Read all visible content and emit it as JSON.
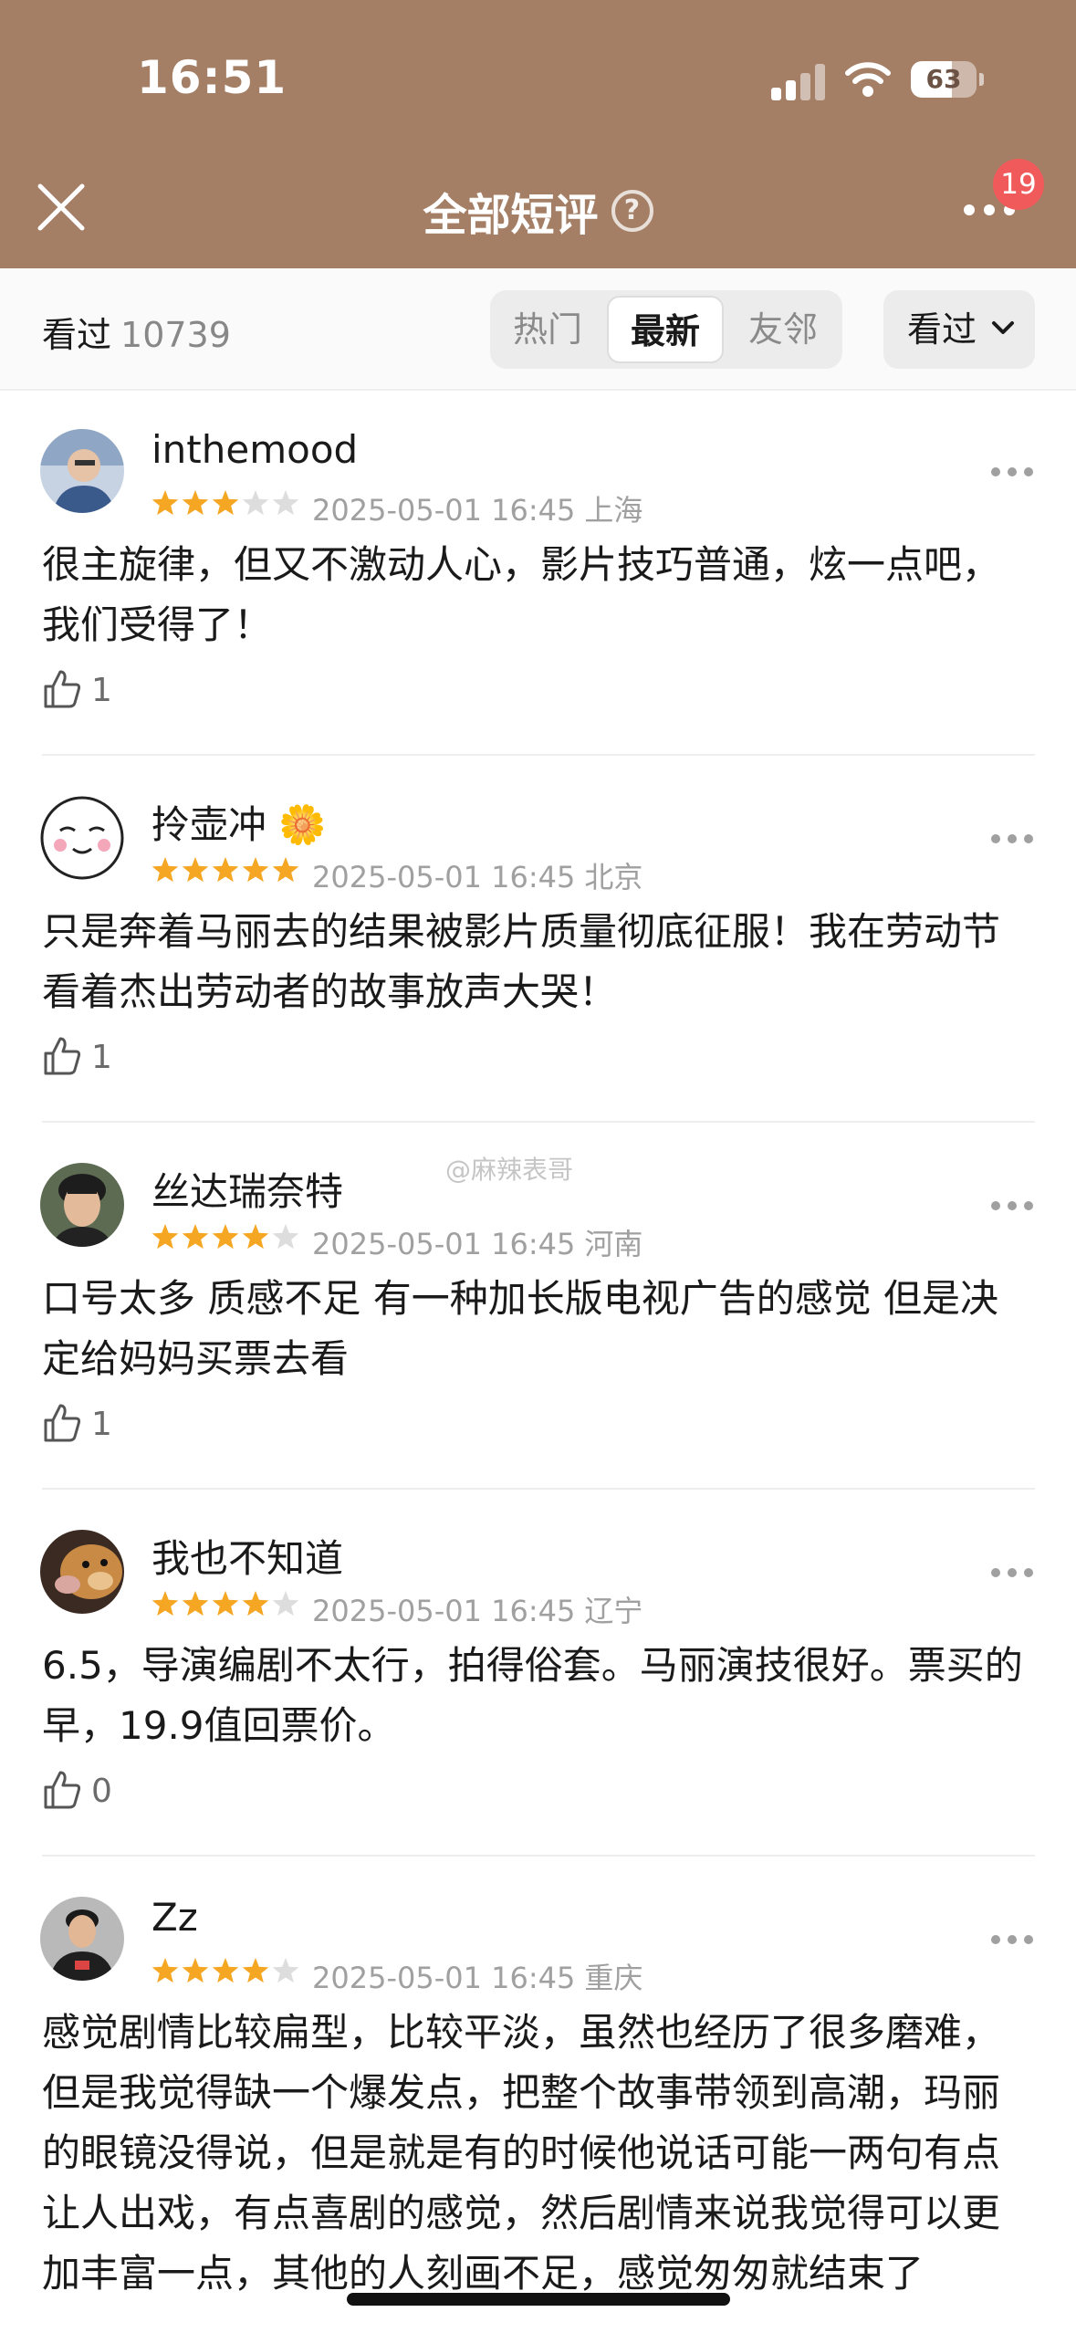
{
  "status_bar": {
    "time": "16:51",
    "battery": "63"
  },
  "nav": {
    "title": "全部短评",
    "help_icon": "question-circle-icon",
    "more_icon": "more-dots-icon",
    "badge_count": "19",
    "close_icon": "close-icon"
  },
  "filter": {
    "seen_label": "看过",
    "seen_count": "10739",
    "tabs": [
      {
        "label": "热门",
        "active": false
      },
      {
        "label": "最新",
        "active": true
      },
      {
        "label": "友邻",
        "active": false
      }
    ],
    "dropdown_label": "看过"
  },
  "colors": {
    "header_bg": "#a47f66",
    "star": "#f5a623",
    "star_empty": "#dddddd",
    "badge": "#f05a5a"
  },
  "reviews": [
    {
      "user": "inthemood",
      "rating": 3,
      "time": "2025-05-01 16:45",
      "location": "上海",
      "text": "很主旋律，但又不激动人心，影片技巧普通，炫一点吧，我们受得了！",
      "likes": "1"
    },
    {
      "user": "拎壶冲",
      "user_emoji": "🌼",
      "rating": 5,
      "time": "2025-05-01 16:45",
      "location": "北京",
      "text": "只是奔着马丽去的结果被影片质量彻底征服！我在劳动节看着杰出劳动者的故事放声大哭！",
      "likes": "1"
    },
    {
      "user": "丝达瑞奈特",
      "rating": 4,
      "time": "2025-05-01 16:45",
      "location": "河南",
      "text": "口号太多 质感不足 有一种加长版电视广告的感觉 但是决定给妈妈买票去看",
      "likes": "1"
    },
    {
      "user": "我也不知道",
      "rating": 4,
      "time": "2025-05-01 16:45",
      "location": "辽宁",
      "text": "6.5，导演编剧不太行，拍得俗套。马丽演技很好。票买的早，19.9值回票价。",
      "likes": "0"
    },
    {
      "user": "Zz",
      "rating": 4,
      "time": "2025-05-01 16:45",
      "location": "重庆",
      "text": "感觉剧情比较扁型，比较平淡，虽然也经历了很多磨难，但是我觉得缺一个爆发点，把整个故事带领到高潮，玛丽的眼镜没得说，但是就是有的时候他说话可能一两句有点让人出戏，有点喜剧的感觉，然后剧情来说我觉得可以更加丰富一点，其他的人刻画不足，感觉匆匆就结束了",
      "likes": ""
    }
  ],
  "watermark": "@麻辣表哥"
}
